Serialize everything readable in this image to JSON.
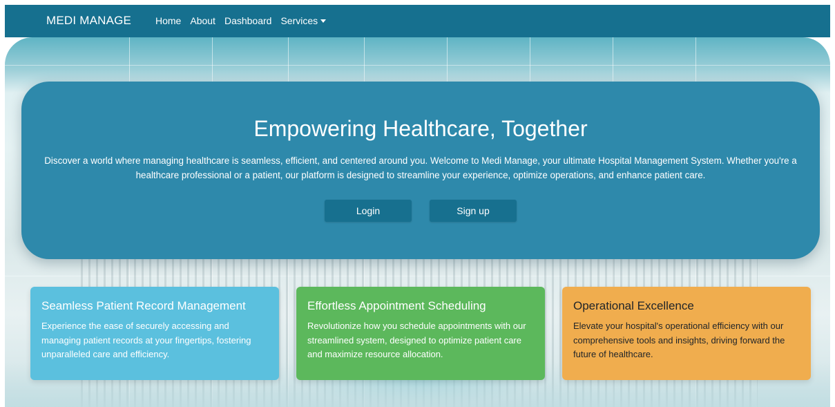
{
  "navbar": {
    "brand": "MEDI MANAGE",
    "links": [
      {
        "label": "Home"
      },
      {
        "label": "About"
      },
      {
        "label": "Dashboard"
      },
      {
        "label": "Services"
      }
    ],
    "services_icon": "caret-down-icon"
  },
  "hero": {
    "title": "Empowering Healthcare, Together",
    "text": "Discover a world where managing healthcare is seamless, efficient, and centered around you. Welcome to Medi Manage, your ultimate Hospital Management System. Whether you're a healthcare professional or a patient, our platform is designed to streamline your experience, optimize operations, and enhance patient care.",
    "login_label": "Login",
    "signup_label": "Sign up"
  },
  "features": [
    {
      "title": "Seamless Patient Record Management",
      "text": "Experience the ease of securely accessing and managing patient records at your fingertips, fostering unparalleled care and efficiency.",
      "color": "#5bc0de"
    },
    {
      "title": "Effortless Appointment Scheduling",
      "text": "Revolutionize how you schedule appointments with our streamlined system, designed to optimize patient care and maximize resource allocation.",
      "color": "#5cb85c"
    },
    {
      "title": "Operational Excellence",
      "text": "Elevate your hospital's operational efficiency with our comprehensive tools and insights, driving forward the future of healthcare.",
      "color": "#f0ad4e"
    }
  ],
  "colors": {
    "navbar": "#16708f",
    "hero": "#2e89ab",
    "button": "#17708f"
  }
}
